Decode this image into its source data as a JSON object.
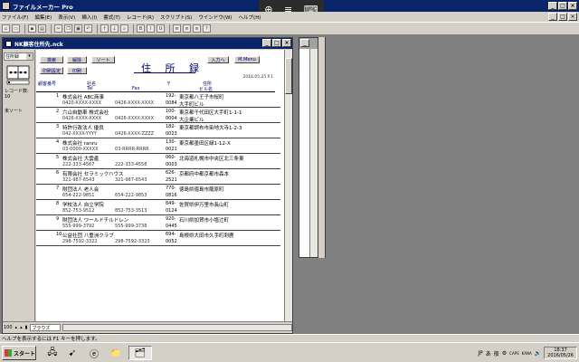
{
  "app": {
    "title": "ファイルメーカー Pro"
  },
  "remote_toolbar": {
    "zoom_icon": "⊕",
    "menu_icon": "≡",
    "keyboard_icon": "⌨"
  },
  "menu": [
    "ファイル(F)",
    "編集(E)",
    "表示(V)",
    "挿入(I)",
    "書式(T)",
    "レコード(R)",
    "スクリプト(S)",
    "ウインドウ(W)",
    "ヘルプ(H)"
  ],
  "document": {
    "title": "NK顧客住所先.nck",
    "layout": "住所録",
    "record_label": "レコード数:",
    "record_count": "10",
    "sort_status": "未ソート",
    "zoom": "100",
    "mode": "ブラウズ"
  },
  "buttons": {
    "search": "検索",
    "unlock": "解除",
    "sort": "ソート",
    "entry": "入力へ",
    "menu": "M.Menu",
    "print_settings": "印刷設定",
    "print": "印刷"
  },
  "page_title": "住 所 録",
  "date": "2016.05.25 P.1",
  "headers": {
    "id": "顧客番号",
    "company": "社名",
    "tel": "Tel",
    "fax": "Fax",
    "zip": "〒",
    "address": "住所",
    "building": "ビル名"
  },
  "records": [
    {
      "num": "1",
      "company": "株式会社 ABC商事",
      "tel": "0420-XXXX-XXXX",
      "fax": "0426-XXXX-XXXX",
      "zip1": "192-",
      "zip2": "0084",
      "addr1": "東京都八王子市桜町",
      "addr2": "大手町ビル"
    },
    {
      "num": "2",
      "company": "六山自動車 株式会社",
      "tel": "0426-XXXX-XXXX",
      "fax": "0426-XXXX-XXXX",
      "zip1": "100-",
      "zip2": "0004",
      "addr1": "東京都千代田区大手町1-1-1",
      "addr2": "大企業ビル"
    },
    {
      "num": "3",
      "company": "特許行政法人 優良",
      "tel": "042-XXXX-YYYY",
      "fax": "0426-XXXX-ZZZZ",
      "zip1": "182-",
      "zip2": "0023",
      "addr1": "東京都調布市染地大寺1-2-3",
      "addr2": ""
    },
    {
      "num": "4",
      "company": "株式会社 ranru",
      "tel": "03-0000-XXXXX",
      "fax": "03-RRRR-RRRR",
      "zip1": "130-",
      "zip2": "0021",
      "addr1": "東京都墨田区緑1-12-X",
      "addr2": ""
    },
    {
      "num": "5",
      "company": "株式会社 大雲產",
      "tel": "222-333-4567",
      "fax": "222-333-4558",
      "zip1": "060-",
      "zip2": "0003",
      "addr1": "北海道札幌市中央区北三条東",
      "addr2": ""
    },
    {
      "num": "6",
      "company": "有限会社 セラミックハウス",
      "tel": "321-987-6543",
      "fax": "321-987-6543",
      "zip1": "626-",
      "zip2": "2521",
      "addr1": "京都府中都京都市森本",
      "addr2": ""
    },
    {
      "num": "7",
      "company": "財団法人 老人会",
      "tel": "654-222-9851",
      "fax": "654-222-9853",
      "zip1": "770-",
      "zip2": "0816",
      "addr1": "徳島県徳島市籠原町",
      "addr2": ""
    },
    {
      "num": "8",
      "company": "学校法人 自立学院",
      "tel": "852-753-9512",
      "fax": "852-753-3513",
      "zip1": "849-",
      "zip2": "0124",
      "addr1": "佐賀県伊万里市長山町",
      "addr2": ""
    },
    {
      "num": "9",
      "company": "財団法人 ワールドチルドレン",
      "tel": "555-999-3792",
      "fax": "555-999-3738",
      "zip1": "920-",
      "zip2": "0445",
      "addr1": "石川県加賀市小塩辻町",
      "addr2": ""
    },
    {
      "num": "10",
      "company": "公益社団 八重洲クラブ",
      "tel": "298-7592-3322",
      "fax": "298-7592-3323",
      "zip1": "694-",
      "zip2": "0052",
      "addr1": "島根県大田市久手町刺鹿",
      "addr2": ""
    }
  ],
  "statusbar": {
    "text": "ヘルプを表示するには F1 キーを押します。"
  },
  "taskbar": {
    "start": "スタート",
    "ime": "JP",
    "caps": "CAPS",
    "kana": "KANA",
    "time": "18:37",
    "date": "2016/05/26"
  }
}
